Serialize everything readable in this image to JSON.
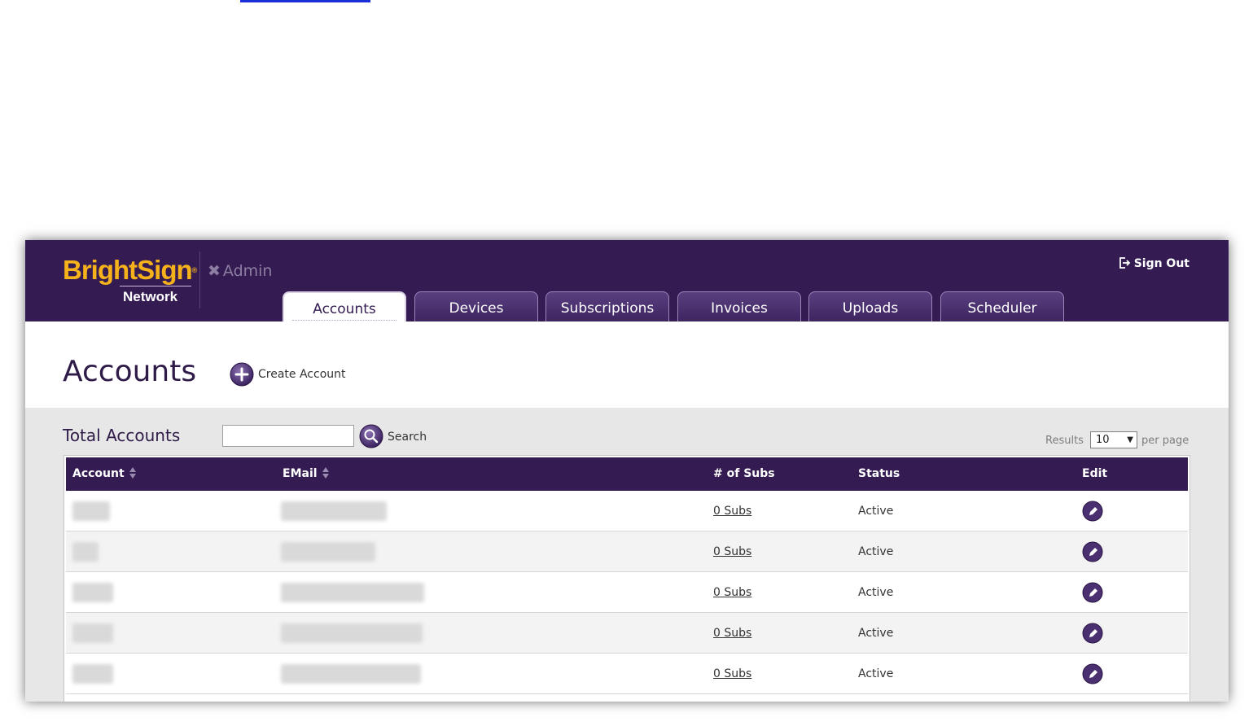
{
  "header": {
    "logo_main": "BrightSign",
    "logo_tm": "®",
    "logo_sub": "Network",
    "admin_label": "Admin",
    "sign_out_label": "Sign Out"
  },
  "tabs": [
    {
      "label": "Accounts",
      "active": true
    },
    {
      "label": "Devices",
      "active": false
    },
    {
      "label": "Subscriptions",
      "active": false
    },
    {
      "label": "Invoices",
      "active": false
    },
    {
      "label": "Uploads",
      "active": false
    },
    {
      "label": "Scheduler",
      "active": false
    }
  ],
  "page": {
    "title": "Accounts",
    "create_label": "Create Account"
  },
  "toolbar": {
    "total_label": "Total Accounts",
    "search_value": "",
    "search_label": "Search",
    "results_label": "Results",
    "per_page_value": "10",
    "per_page_label": "per page"
  },
  "table": {
    "columns": [
      "Account",
      "EMail",
      "# of Subs",
      "Status",
      "Edit"
    ],
    "rows": [
      {
        "subs": "0 Subs",
        "status": "Active"
      },
      {
        "subs": "0 Subs",
        "status": "Active"
      },
      {
        "subs": "0 Subs",
        "status": "Active"
      },
      {
        "subs": "0 Subs",
        "status": "Active"
      },
      {
        "subs": "0 Subs",
        "status": "Active"
      }
    ]
  },
  "colors": {
    "header_bg": "#341c52",
    "logo_accent": "#f5b21b",
    "content_bg": "#e7e7e7",
    "row_alt_bg": "#f3f3f3"
  },
  "icons": [
    "tools-icon",
    "sign-out-icon",
    "plus-circle-icon",
    "search-icon",
    "sort-icon",
    "edit-pencil-icon"
  ]
}
